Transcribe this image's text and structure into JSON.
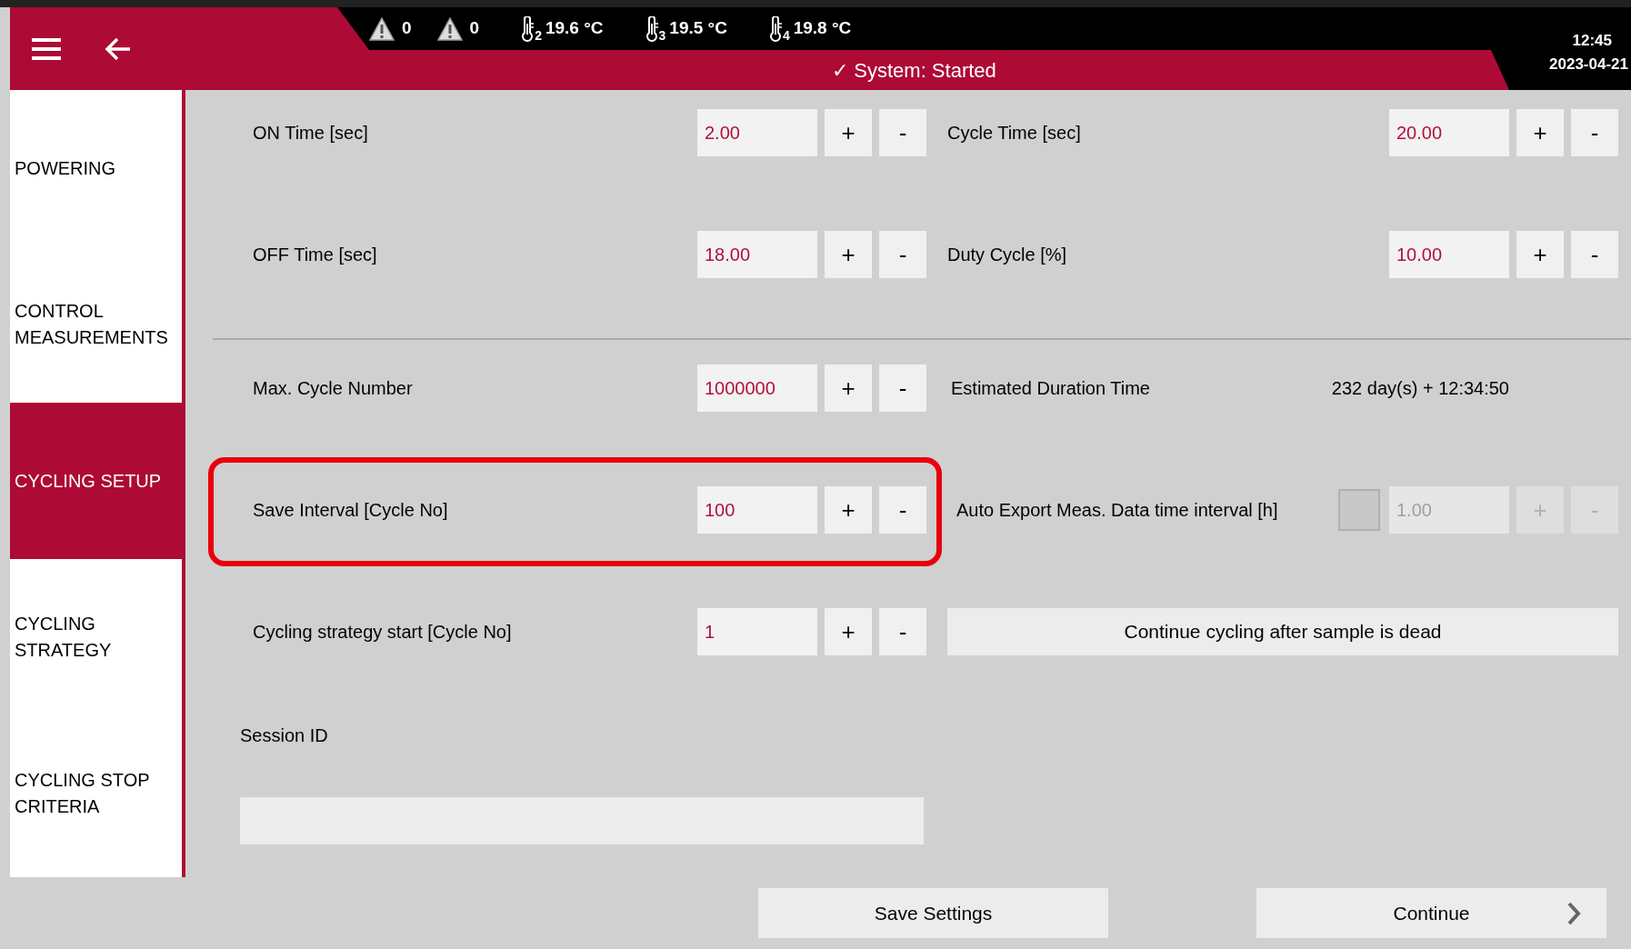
{
  "header": {
    "alarms": [
      {
        "count": "0"
      },
      {
        "count": "0"
      }
    ],
    "temperatures": [
      {
        "sensor": "2",
        "value": "19.6 °C"
      },
      {
        "sensor": "3",
        "value": "19.5 °C"
      },
      {
        "sensor": "4",
        "value": "19.8 °C"
      }
    ],
    "status": "✓ System: Started",
    "time": "12:45",
    "date": "2023-04-21"
  },
  "sidebar": {
    "items": [
      {
        "label": "POWERING",
        "selected": false
      },
      {
        "label": "CONTROL MEASUREMENTS",
        "selected": false
      },
      {
        "label": "CYCLING SETUP",
        "selected": true
      },
      {
        "label": "CYCLING STRATEGY",
        "selected": false
      },
      {
        "label": "CYCLING STOP CRITERIA",
        "selected": false
      }
    ]
  },
  "rows": [
    {
      "kind": "settings",
      "items": [
        {
          "kind": "stepper",
          "label": "ON Time [sec]",
          "value": "2.00"
        },
        {
          "kind": "stepper",
          "label": "Cycle Time [sec]",
          "value": "20.00"
        }
      ]
    },
    {
      "kind": "settings",
      "items": [
        {
          "kind": "stepper",
          "label": "OFF Time [sec]",
          "value": "18.00"
        },
        {
          "kind": "stepper",
          "label": "Duty Cycle [%]",
          "value": "10.00"
        }
      ]
    },
    {
      "kind": "divider"
    },
    {
      "kind": "settings",
      "items": [
        {
          "kind": "stepper",
          "label": "Max. Cycle Number",
          "value": "1000000"
        },
        {
          "kind": "readout",
          "label": "Estimated Duration Time",
          "value": "232 day(s) + 12:34:50"
        }
      ]
    },
    {
      "kind": "settings",
      "items": [
        {
          "kind": "stepper",
          "label": "Save Interval [Cycle No]",
          "value": "100",
          "highlighted": true
        },
        {
          "kind": "checkbox_stepper",
          "label": "Auto Export Meas. Data time interval [h]",
          "checked": false,
          "value": "1.00",
          "disabled": true
        }
      ]
    },
    {
      "kind": "settings",
      "items": [
        {
          "kind": "stepper",
          "label": "Cycling strategy start [Cycle No]",
          "value": "1"
        },
        {
          "kind": "button",
          "label": "Continue cycling after sample is dead"
        }
      ]
    }
  ],
  "session": {
    "label": "Session ID"
  },
  "buttons": [
    {
      "kind": "plain",
      "label": "Save Settings"
    },
    {
      "kind": "next",
      "label": "Continue"
    }
  ],
  "stepper_signs": {
    "plus": "+",
    "minus": "-"
  }
}
